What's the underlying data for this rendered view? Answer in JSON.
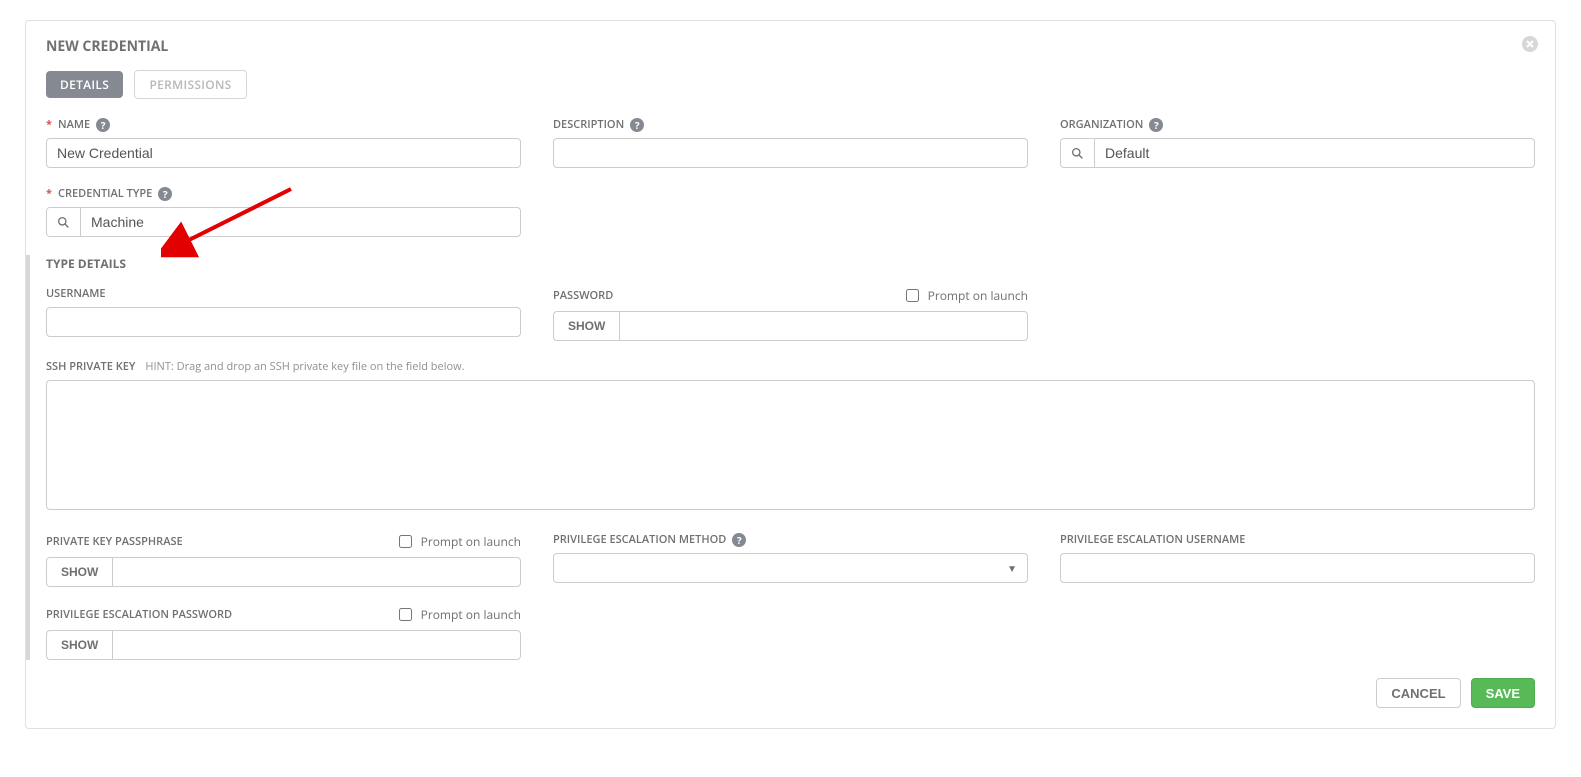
{
  "panel_title": "NEW CREDENTIAL",
  "tabs": {
    "details": "DETAILS",
    "permissions": "PERMISSIONS"
  },
  "labels": {
    "name": "NAME",
    "description": "DESCRIPTION",
    "organization": "ORGANIZATION",
    "credential_type": "CREDENTIAL TYPE",
    "type_details": "TYPE DETAILS",
    "username": "USERNAME",
    "password": "PASSWORD",
    "ssh_private_key": "SSH PRIVATE KEY",
    "ssh_hint": "HINT: Drag and drop an SSH private key file on the field below.",
    "private_key_passphrase": "PRIVATE KEY PASSPHRASE",
    "privilege_escalation_method": "PRIVILEGE ESCALATION METHOD",
    "privilege_escalation_username": "PRIVILEGE ESCALATION USERNAME",
    "privilege_escalation_password": "PRIVILEGE ESCALATION PASSWORD",
    "prompt_on_launch": "Prompt on launch",
    "show": "SHOW",
    "cancel": "CANCEL",
    "save": "SAVE",
    "required_mark": "*"
  },
  "values": {
    "name": "New Credential",
    "description": "",
    "organization": "Default",
    "credential_type": "Machine",
    "username": "",
    "password": "",
    "ssh_private_key": "",
    "private_key_passphrase": "",
    "privilege_escalation_method": "",
    "privilege_escalation_username": "",
    "privilege_escalation_password": ""
  },
  "checkboxes": {
    "password_prompt": false,
    "passphrase_prompt": false,
    "escalation_password_prompt": false
  }
}
